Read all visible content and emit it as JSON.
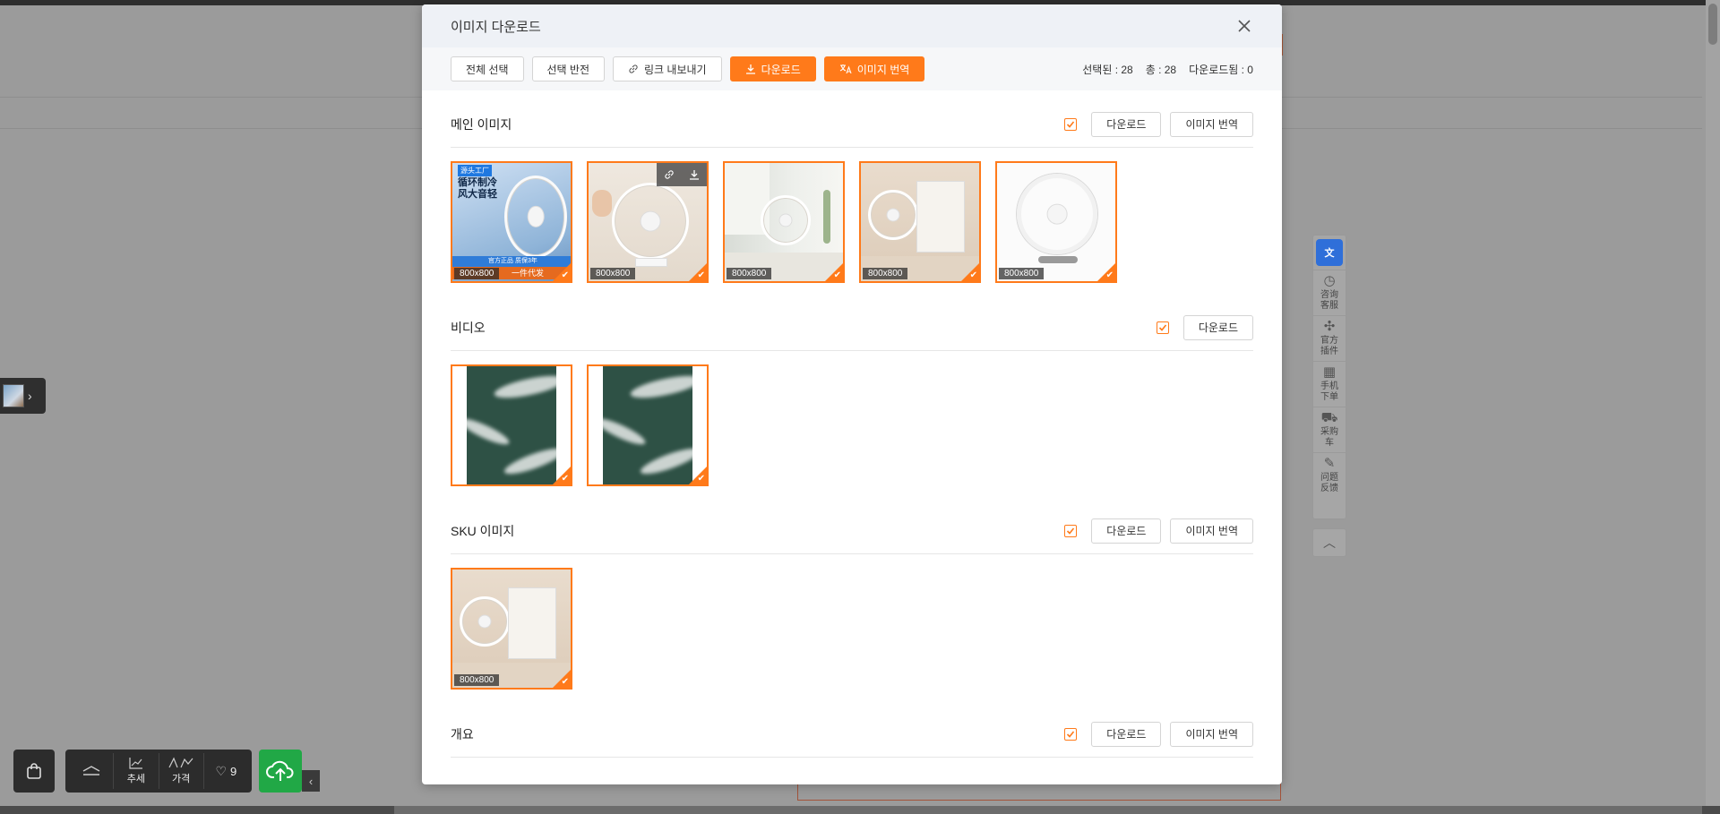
{
  "modal": {
    "title": "이미지 다운로드",
    "toolbar": {
      "select_all": "전체 선택",
      "invert_selection": "선택 반전",
      "export_links": "링크 내보내기",
      "download": "다운로드",
      "translate_images": "이미지 번역"
    },
    "stats": {
      "selected": "선택된 : 28",
      "total": "총 : 28",
      "downloaded": "다운로드됨 : 0"
    },
    "sections": {
      "main": {
        "title": "메인 이미지",
        "download": "다운로드",
        "translate": "이미지 번역",
        "images": [
          {
            "size": "800x800",
            "badge": "源头工厂",
            "headline": "循环制冷 风大音轻",
            "footer": "官方正品 质保3年",
            "footer2": "一件代发"
          },
          {
            "size": "800x800"
          },
          {
            "size": "800x800"
          },
          {
            "size": "800x800"
          },
          {
            "size": "800x800"
          }
        ]
      },
      "video": {
        "title": "비디오",
        "download": "다운로드"
      },
      "sku": {
        "title": "SKU 이미지",
        "download": "다운로드",
        "translate": "이미지 번역",
        "images": [
          {
            "size": "800x800"
          }
        ]
      },
      "overview": {
        "title": "개요",
        "download": "다운로드",
        "translate": "이미지 번역"
      }
    }
  },
  "bottom_toolbar": {
    "trend": "추세",
    "price": "가격",
    "favorites": "9"
  },
  "right_toolbar": {
    "items": [
      "咨询客服",
      "官方插件",
      "手机下单",
      "采购车",
      "问题反馈"
    ]
  },
  "colors": {
    "accent": "#ff7a1a",
    "upload_green": "#21a846"
  }
}
